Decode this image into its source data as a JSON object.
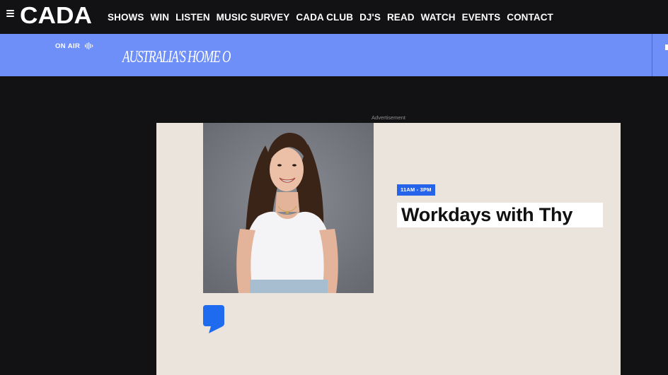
{
  "header": {
    "logo_text": "CADA",
    "nav_items": [
      "SHOWS",
      "WIN",
      "LISTEN",
      "MUSIC SURVEY",
      "CADA CLUB",
      "DJ'S",
      "READ",
      "WATCH",
      "EVENTS",
      "CONTACT"
    ]
  },
  "on_air": {
    "label": "ON AIR",
    "ticker_text": "AUSTRALIA'S HOME O"
  },
  "advertisement_label": "Advertisement",
  "show": {
    "time": "11AM - 3PM",
    "title": "Workdays with Thy"
  },
  "colors": {
    "background": "#121114",
    "on_air_bar": "#6e8ef8",
    "card": "#ebe4dd",
    "badge": "#2563eb",
    "quote_icon": "#1f6bf0"
  },
  "icons": {
    "menu": "hamburger-menu-icon",
    "on_air": "audio-wave-icon",
    "quote": "speech-bubble-icon"
  }
}
